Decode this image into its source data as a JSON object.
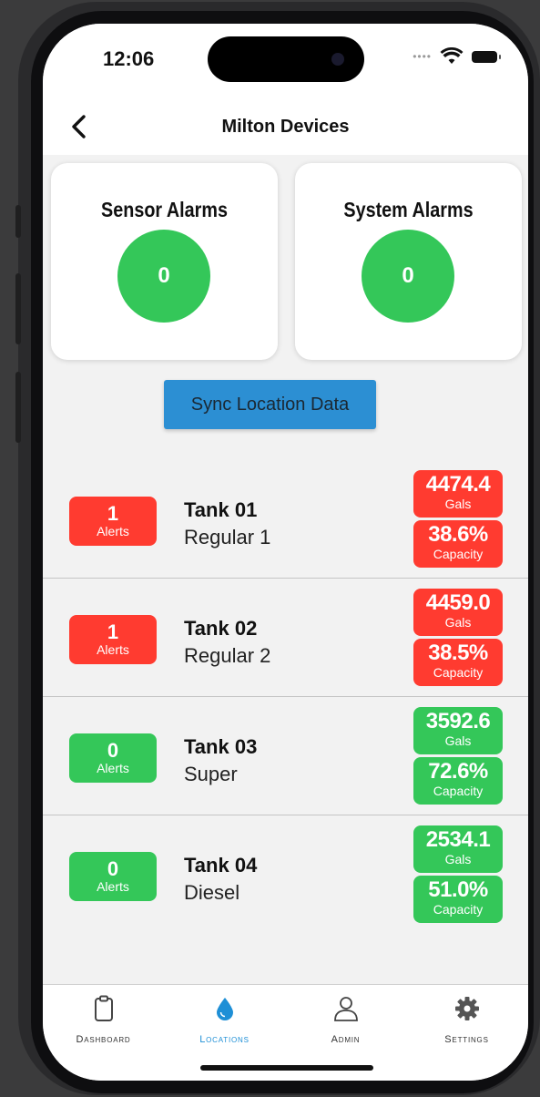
{
  "status": {
    "time": "12:06"
  },
  "nav": {
    "title": "Milton Devices"
  },
  "cards": [
    {
      "title": "Sensor Alarms",
      "count": "0"
    },
    {
      "title": "System Alarms",
      "count": "0"
    }
  ],
  "sync_button": "Sync Location Data",
  "tanks": [
    {
      "alerts": "1",
      "alerts_label": "Alerts",
      "name": "Tank 01",
      "product": "Regular 1",
      "gals": "4474.4",
      "gals_label": "Gals",
      "capacity": "38.6%",
      "capacity_label": "Capacity",
      "status": "alert"
    },
    {
      "alerts": "1",
      "alerts_label": "Alerts",
      "name": "Tank 02",
      "product": "Regular 2",
      "gals": "4459.0",
      "gals_label": "Gals",
      "capacity": "38.5%",
      "capacity_label": "Capacity",
      "status": "alert"
    },
    {
      "alerts": "0",
      "alerts_label": "Alerts",
      "name": "Tank 03",
      "product": "Super",
      "gals": "3592.6",
      "gals_label": "Gals",
      "capacity": "72.6%",
      "capacity_label": "Capacity",
      "status": "ok"
    },
    {
      "alerts": "0",
      "alerts_label": "Alerts",
      "name": "Tank 04",
      "product": "Diesel",
      "gals": "2534.1",
      "gals_label": "Gals",
      "capacity": "51.0%",
      "capacity_label": "Capacity",
      "status": "ok"
    }
  ],
  "tabs": [
    {
      "label": "Dashboard",
      "icon": "clipboard-icon"
    },
    {
      "label": "Locations",
      "icon": "water-drop-icon",
      "active": true
    },
    {
      "label": "Admin",
      "icon": "person-icon"
    },
    {
      "label": "Settings",
      "icon": "gear-icon"
    }
  ],
  "colors": {
    "alert": "#ff3b30",
    "ok": "#34c759",
    "accent": "#1e8fd6",
    "sync": "#2c8fd3"
  }
}
